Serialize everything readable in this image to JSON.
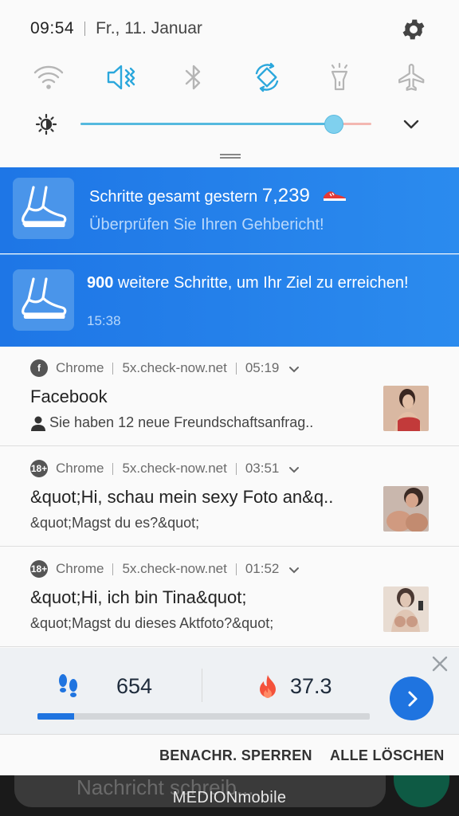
{
  "status": {
    "time": "09:54",
    "date": "Fr., 11. Januar"
  },
  "quick_settings": {
    "toggles": [
      {
        "icon": "wifi-icon",
        "active": false
      },
      {
        "icon": "mute-icon",
        "active": true
      },
      {
        "icon": "bluetooth-icon",
        "active": false
      },
      {
        "icon": "auto-rotate-icon",
        "active": true
      },
      {
        "icon": "flashlight-icon",
        "active": false
      },
      {
        "icon": "airplane-icon",
        "active": false
      }
    ],
    "brightness_level": 0.87,
    "accent_color": "#2ba7dc"
  },
  "step_notifications": {
    "first": {
      "title_prefix": "Schritte gesamt gestern",
      "title_value": "7,239",
      "subtitle": "Überprüfen Sie Ihren Gehbericht!"
    },
    "second": {
      "title_bold": "900",
      "title_rest": " weitere Schritte, um Ihr Ziel zu erreichen!",
      "time": "15:38"
    },
    "bg_color": "#1e76e6"
  },
  "chrome_notifications": [
    {
      "icon_text": "f",
      "app": "Chrome",
      "site": "5x.check-now.net",
      "time": "05:19",
      "title": "Facebook",
      "body": "Sie haben 12 neue Freundschaftsanfrag..",
      "thumb_colors": [
        "#d9b8a2",
        "#c23a3a",
        "#8a5a48"
      ]
    },
    {
      "icon_text": "18+",
      "app": "Chrome",
      "site": "5x.check-now.net",
      "time": "03:51",
      "title": "&quot;Hi, schau mein sexy Foto an&q..",
      "body": "&quot;Magst du es?&quot;",
      "thumb_colors": [
        "#d6a58c",
        "#c28b70",
        "#3a2a24"
      ]
    },
    {
      "icon_text": "18+",
      "app": "Chrome",
      "site": "5x.check-now.net",
      "time": "01:52",
      "title": "&quot;Hi, ich bin Tina&quot;",
      "body": "&quot;Magst du dieses Aktfoto?&quot;",
      "thumb_colors": [
        "#e0c6b4",
        "#c99a84",
        "#4a3832"
      ]
    }
  ],
  "step_widget": {
    "steps": "654",
    "calories": "37.3",
    "progress": 0.11,
    "accent": "#1f74e0"
  },
  "actions": {
    "block": "BENACHR. SPERREN",
    "clear": "ALLE LÖSCHEN"
  },
  "background": {
    "message_placeholder": "Nachricht schreib...",
    "brand": "MEDIONmobile"
  }
}
